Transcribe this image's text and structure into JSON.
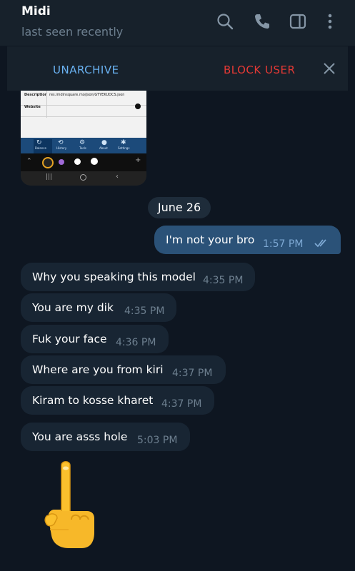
{
  "header": {
    "title": "Midi",
    "status": "last seen recently",
    "icons": [
      "search-icon",
      "phone-icon",
      "sidebar-icon",
      "more-icon"
    ]
  },
  "action_bar": {
    "unarchive_label": "UNARCHIVE",
    "block_label": "BLOCK USER",
    "close_icon": "close-icon"
  },
  "thumbnail": {
    "rows": [
      {
        "key": "Description",
        "value": "res.imdinsquare.mo/json/GTYEKUDCS.json"
      },
      {
        "key": "Website",
        "value": ""
      }
    ],
    "nav_items": [
      "Balance",
      "History",
      "Tools",
      "About",
      "Settings"
    ]
  },
  "date_separator": "June 26",
  "messages": [
    {
      "direction": "out",
      "text": "I'm not your bro",
      "time": "1:57 PM",
      "read": true
    },
    {
      "direction": "in",
      "text": "Why you speaking this model",
      "time": "4:35 PM"
    },
    {
      "direction": "in",
      "text": "You are my dik",
      "time": "4:35 PM"
    },
    {
      "direction": "in",
      "text": "Fuk your face",
      "time": "4:36 PM"
    },
    {
      "direction": "in",
      "text": "Where are you from kiri",
      "time": "4:37 PM"
    },
    {
      "direction": "in",
      "text": "Kiram to kosse kharet",
      "time": "4:37 PM"
    },
    {
      "direction": "in",
      "text": "You are asss hole",
      "time": "5:03 PM"
    }
  ],
  "sticker": "middle-finger-emoji",
  "colors": {
    "background": "#0e1621",
    "header": "#17212b",
    "outgoing_bubble": "#2b5278",
    "incoming_bubble": "#182533",
    "link": "#6ab2f2",
    "danger": "#e53935"
  }
}
